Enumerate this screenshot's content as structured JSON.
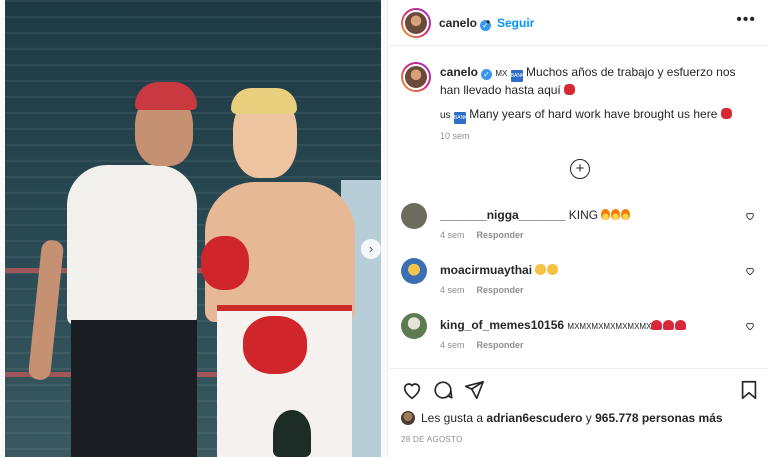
{
  "post": {
    "username": "canelo",
    "follow_label": "Seguir",
    "separator": "•",
    "more_label": "•••",
    "next_arrow": "›"
  },
  "caption": {
    "username": "canelo",
    "country_code": "MX",
    "flag_text": "BANK",
    "text": "Muchos años de trabajo y esfuerzo nos han llevado hasta aquí",
    "translation_prefix": "us",
    "translation": "Many years of hard work have brought us here",
    "time": "10 sem"
  },
  "load_more": "+",
  "comments": [
    {
      "user": "_______nigga_______",
      "text": "KING",
      "emoji": "fire",
      "emoji_count": 3,
      "time": "4 sem",
      "reply": "Responder",
      "avatar_color": "#6d6a5e"
    },
    {
      "user": "moacirmuaythai",
      "text": "",
      "emoji": "clap",
      "emoji_count": 2,
      "time": "4 sem",
      "reply": "Responder",
      "avatar_color": "#3b6fb3"
    },
    {
      "user": "king_of_memes10156",
      "text": "MXMXMXMXMXMXMX",
      "emoji": "heart",
      "emoji_count": 3,
      "time": "4 sem",
      "reply": "Responder",
      "avatar_color": "#5d7a52"
    }
  ],
  "likes": {
    "prefix": "Les gusta a",
    "user": "adrian6escudero",
    "middle": "y",
    "count": "965.778 personas más"
  },
  "date": "28 DE AGOSTO",
  "colors": {
    "accent": "#0095f6",
    "verified": "#3897f0",
    "text": "#262626",
    "muted": "#8e8e8e",
    "border": "#efefef"
  }
}
